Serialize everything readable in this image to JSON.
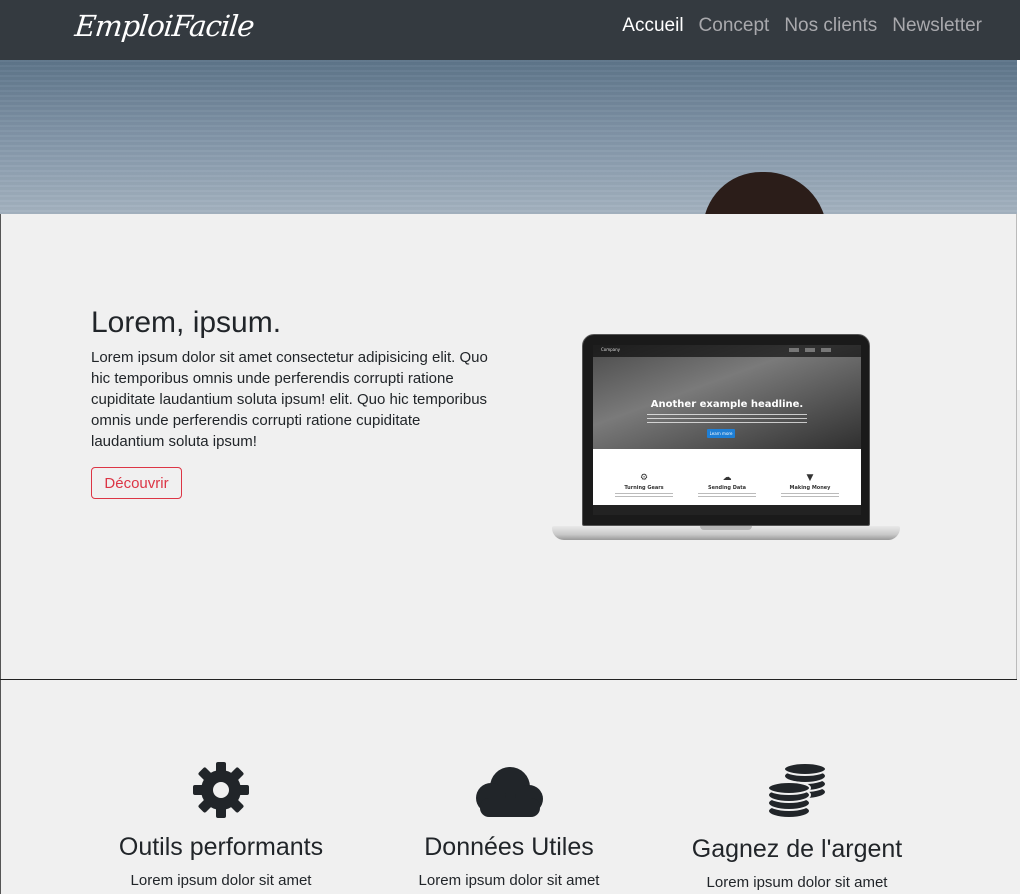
{
  "navbar": {
    "brand": "EmploiFacile",
    "links": [
      {
        "label": "Accueil",
        "active": true
      },
      {
        "label": "Concept",
        "active": false
      },
      {
        "label": "Nos clients",
        "active": false
      },
      {
        "label": "Newsletter",
        "active": false
      }
    ]
  },
  "intro": {
    "heading": "Lorem, ipsum.",
    "text": "Lorem ipsum dolor sit amet consectetur adipisicing elit. Quo hic temporibus omnis unde perferendis corrupti ratione cupiditate laudantium soluta ipsum! elit. Quo hic temporibus omnis unde perferendis corrupti ratione cupiditate laudantium soluta ipsum!",
    "button_label": "Découvrir"
  },
  "laptop_screen": {
    "brand": "Company",
    "headline": "Another example headline.",
    "button": "Learn more",
    "features": [
      {
        "icon": "gear-icon",
        "title": "Turning Gears"
      },
      {
        "icon": "cloud-icon",
        "title": "Sending Data"
      },
      {
        "icon": "cart-icon",
        "title": "Making Money"
      }
    ]
  },
  "features": [
    {
      "icon": "gear-icon",
      "title": "Outils performants",
      "text": "Lorem ipsum dolor sit amet"
    },
    {
      "icon": "cloud-icon",
      "title": "Données Utiles",
      "text": "Lorem ipsum dolor sit amet"
    },
    {
      "icon": "coins-icon",
      "title": "Gagnez de l'argent",
      "text": "Lorem ipsum dolor sit amet"
    }
  ],
  "colors": {
    "navbar": "#343a40",
    "page_background": "#f0f0f0",
    "accent_red": "#dc3545",
    "icon": "#212529"
  }
}
